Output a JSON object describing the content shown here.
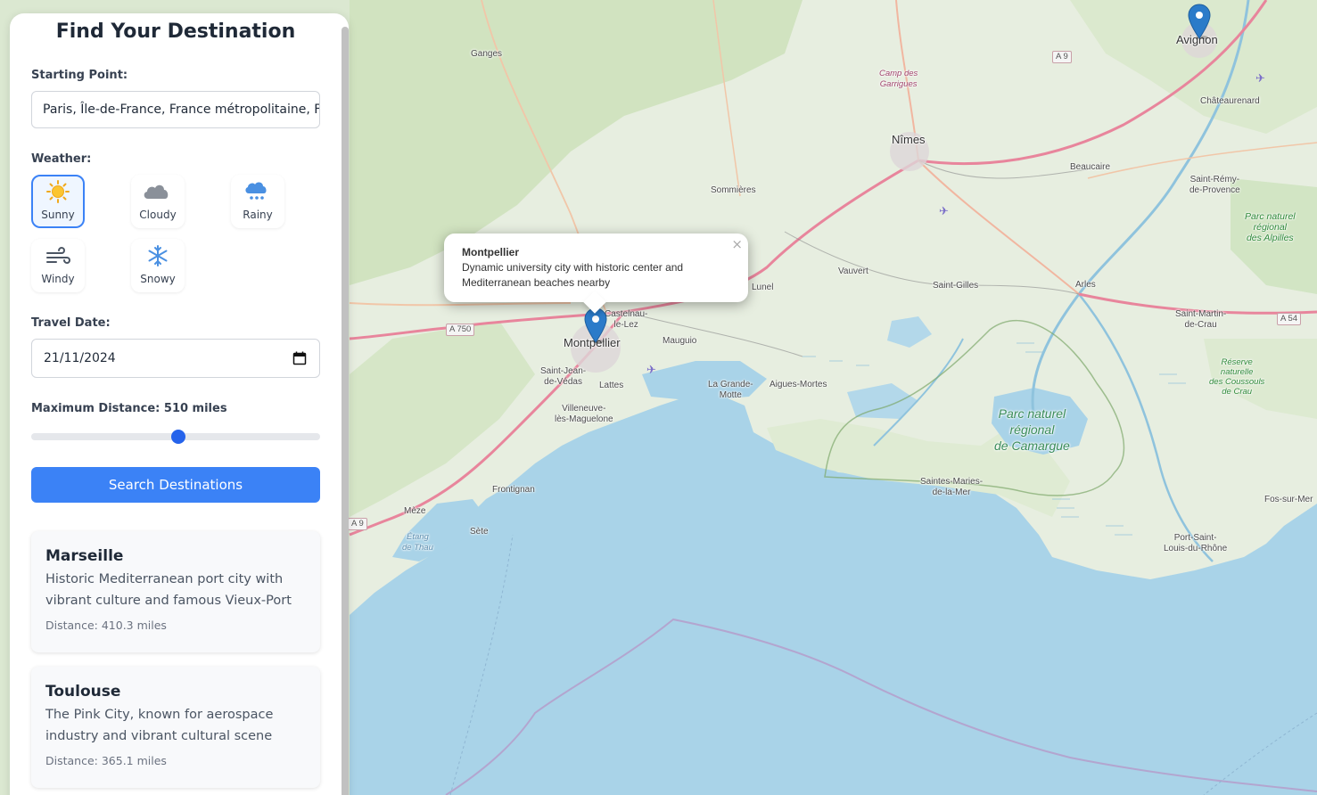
{
  "sidebar": {
    "title": "Find Your Destination",
    "starting_point": {
      "label": "Starting Point:",
      "value": "Paris, Île-de-France, France métropolitaine, France"
    },
    "weather": {
      "label": "Weather:",
      "options": [
        {
          "label": "Sunny",
          "icon": "sun-icon",
          "selected": true
        },
        {
          "label": "Cloudy",
          "icon": "cloud-icon",
          "selected": false
        },
        {
          "label": "Rainy",
          "icon": "rain-cloud-icon",
          "selected": false
        },
        {
          "label": "Windy",
          "icon": "wind-icon",
          "selected": false
        },
        {
          "label": "Snowy",
          "icon": "snowflake-icon",
          "selected": false
        }
      ]
    },
    "travel_date": {
      "label": "Travel Date:",
      "value": "21/11/2024"
    },
    "max_distance": {
      "label": "Maximum Distance: 510 miles",
      "value": 510,
      "fraction": 0.51
    },
    "search_button": "Search Destinations",
    "results": [
      {
        "name": "Marseille",
        "description": "Historic Mediterranean port city with vibrant culture and famous Vieux-Port",
        "distance": "Distance: 410.3 miles"
      },
      {
        "name": "Toulouse",
        "description": "The Pink City, known for aerospace industry and vibrant cultural scene",
        "distance": "Distance: 365.1 miles"
      }
    ]
  },
  "map": {
    "popup": {
      "title": "Montpellier",
      "description": "Dynamic university city with historic center and Mediterranean beaches nearby",
      "close": "×"
    },
    "places": {
      "avignon": "Avignon",
      "nimes": "Nîmes",
      "montpellier": "Montpellier",
      "ganges": "Ganges",
      "sommieres": "Sommières",
      "beaucaire": "Beaucaire",
      "chateaurenard": "Châteaurenard",
      "saint_remy": "Saint-Rémy-\nde-Provence",
      "vauvert": "Vauvert",
      "lunel": "Lunel",
      "saint_gilles": "Saint-Gilles",
      "arles": "Arles",
      "saint_martin": "Saint-Martin-\nde-Crau",
      "castelnau": "Castelnau-\nle-Lez",
      "mauguio": "Mauguio",
      "saint_jean": "Saint-Jean-\nde-Védas",
      "lattes": "Lattes",
      "villeneuve": "Villeneuve-\nlès-Maguelone",
      "la_grande_motte": "La Grande-\nMotte",
      "aigues_mortes": "Aigues-Mortes",
      "frontignan": "Frontignan",
      "meze": "Mèze",
      "sete": "Sète",
      "saintes_maries": "Saintes-Maries-\nde-la-Mer",
      "port_saint_louis": "Port-Saint-\nLouis-du-Rhône",
      "fos": "Fos-sur-Mer"
    },
    "parks": {
      "alpilles": "Parc naturel\nrégional\ndes Alpilles",
      "coussouls": "Réserve\nnaturelle\ndes Coussouls\nde Crau",
      "camargue": "Parc naturel\nrégional\nde Camargue",
      "garrigues": "Camp des\nGarrigues"
    },
    "water": {
      "thau": "Étang\nde Thau"
    },
    "roads": {
      "a9_top": "A 9",
      "a750": "A 750",
      "a54": "A 54",
      "a9_left": "A 9"
    },
    "colors": {
      "sea": "#a9d3e8",
      "land": "#e9efe2",
      "forest": "#c7dfb4",
      "accent": "#3b82f6",
      "marker": "#2b7bc9"
    }
  }
}
